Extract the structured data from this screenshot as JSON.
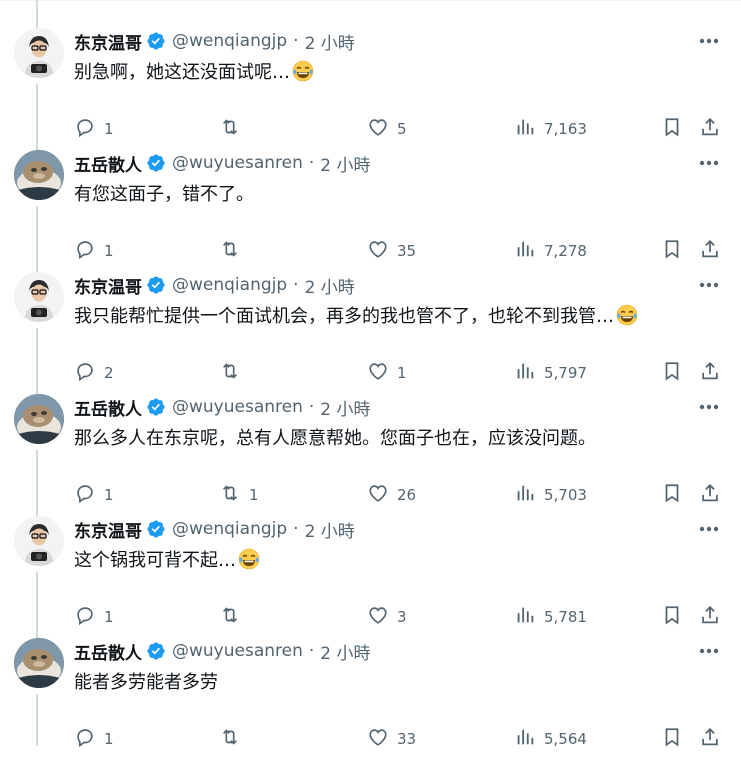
{
  "colors": {
    "text": "#0f1419",
    "muted": "#536471",
    "verified": "#1d9bf0",
    "thread_line": "#cfd9de"
  },
  "tweets": [
    {
      "name": "东京温哥",
      "handle": "@wenqiangjp",
      "sep": "·",
      "time": "2 小時",
      "text": "别急啊，她这还没面试呢…",
      "emoji": true,
      "avatar": "wen",
      "replies": "1",
      "retweets": "",
      "likes": "5",
      "views": "7,163"
    },
    {
      "name": "五岳散人",
      "handle": "@wuyuesanren",
      "sep": "·",
      "time": "2 小時",
      "text": "有您这面子，错不了。",
      "emoji": false,
      "avatar": "wu",
      "replies": "1",
      "retweets": "",
      "likes": "35",
      "views": "7,278"
    },
    {
      "name": "东京温哥",
      "handle": "@wenqiangjp",
      "sep": "·",
      "time": "2 小時",
      "text": "我只能帮忙提供一个面试机会，再多的我也管不了，也轮不到我管…",
      "emoji": true,
      "avatar": "wen",
      "replies": "2",
      "retweets": "",
      "likes": "1",
      "views": "5,797"
    },
    {
      "name": "五岳散人",
      "handle": "@wuyuesanren",
      "sep": "·",
      "time": "2 小時",
      "text": "那么多人在东京呢，总有人愿意帮她。您面子也在，应该没问题。",
      "emoji": false,
      "avatar": "wu",
      "replies": "1",
      "retweets": "1",
      "likes": "26",
      "views": "5,703"
    },
    {
      "name": "东京温哥",
      "handle": "@wenqiangjp",
      "sep": "·",
      "time": "2 小時",
      "text": "这个锅我可背不起…",
      "emoji": true,
      "avatar": "wen",
      "replies": "1",
      "retweets": "",
      "likes": "3",
      "views": "5,781"
    },
    {
      "name": "五岳散人",
      "handle": "@wuyuesanren",
      "sep": "·",
      "time": "2 小時",
      "text": "能者多劳能者多劳",
      "emoji": false,
      "avatar": "wu",
      "replies": "1",
      "retweets": "",
      "likes": "33",
      "views": "5,564"
    }
  ]
}
